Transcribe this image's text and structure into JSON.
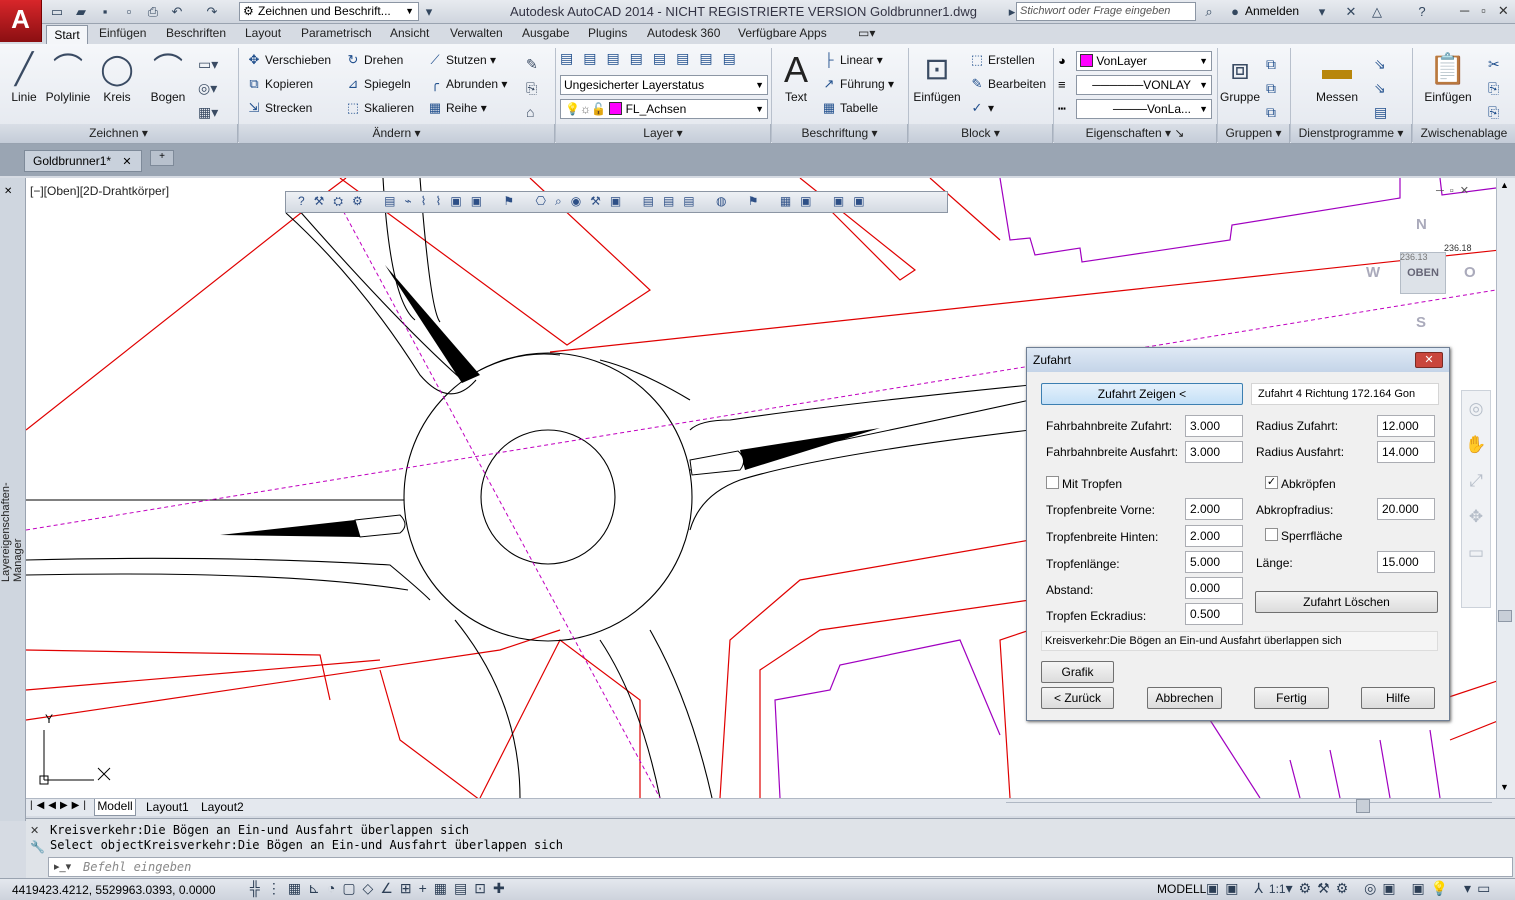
{
  "app": {
    "logo": "A",
    "title": "Autodesk AutoCAD 2014 - NICHT REGISTRIERTE VERSION     Goldbrunner1.dwg",
    "workspace": "Zeichnen und Beschrift...",
    "search_placeholder": "Stichwort oder Frage eingeben",
    "login": "Anmelden"
  },
  "ribbon": {
    "tabs": [
      "Start",
      "Einfügen",
      "Beschriften",
      "Layout",
      "Parametrisch",
      "Ansicht",
      "Verwalten",
      "Ausgabe",
      "Plugins",
      "Autodesk 360",
      "Verfügbare Apps"
    ],
    "zeichnen": {
      "linie": "Linie",
      "polylinie": "Polylinie",
      "kreis": "Kreis",
      "bogen": "Bogen",
      "panel": "Zeichnen"
    },
    "aendern": {
      "verschieben": "Verschieben",
      "drehen": "Drehen",
      "stutzen": "Stutzen",
      "kopieren": "Kopieren",
      "spiegeln": "Spiegeln",
      "abrunden": "Abrunden",
      "strecken": "Strecken",
      "skalieren": "Skalieren",
      "reihe": "Reihe",
      "panel": "Ändern"
    },
    "layer": {
      "status": "Ungesicherter Layerstatus",
      "current": "FL_Achsen",
      "panel": "Layer",
      "layer_color": "#ff00ff"
    },
    "beschriftung": {
      "text": "Text",
      "linear": "Linear",
      "fuehrung": "Führung",
      "tabelle": "Tabelle",
      "panel": "Beschriftung"
    },
    "block": {
      "einfuegen": "Einfügen",
      "erstellen": "Erstellen",
      "bearbeiten": "Bearbeiten",
      "panel": "Block"
    },
    "eigenschaften": {
      "color": "VonLayer",
      "linetype": "VONLAY",
      "lineweight": "VonLa...",
      "panel": "Eigenschaften",
      "color_swatch": "#ff00ff"
    },
    "gruppen": {
      "gruppe": "Gruppe",
      "panel": "Gruppen"
    },
    "dienst": {
      "messen": "Messen",
      "panel": "Dienstprogramme"
    },
    "zwischen": {
      "einfuegen": "Einfügen",
      "panel": "Zwischenablage"
    }
  },
  "file_tab": "Goldbrunner1*",
  "viewport": {
    "label": "[−][Oben][2D-Drahtkörper]",
    "sidebar_label": "Layereigenschaften-Manager",
    "viewcube": {
      "n": "N",
      "s": "S",
      "w": "W",
      "o": "O",
      "face": "OBEN",
      "val1": "236.13",
      "val2": "236.18"
    },
    "ucs_y": "Y"
  },
  "dialog": {
    "title": "Zufahrt",
    "show_btn": "Zufahrt Zeigen <",
    "info": "Zufahrt 4 Richtung 172.164 Gon",
    "fahrbahnbreite_zufahrt": {
      "label": "Fahrbahnbreite Zufahrt:",
      "value": "3.000"
    },
    "fahrbahnbreite_ausfahrt": {
      "label": "Fahrbahnbreite Ausfahrt:",
      "value": "3.000"
    },
    "radius_zufahrt": {
      "label": "Radius Zufahrt:",
      "value": "12.000"
    },
    "radius_ausfahrt": {
      "label": "Radius Ausfahrt:",
      "value": "14.000"
    },
    "mit_tropfen": {
      "label": "Mit Tropfen",
      "checked": false
    },
    "abkroepfen": {
      "label": "Abkröpfen",
      "checked": true
    },
    "tropfenbreite_vorne": {
      "label": "Tropfenbreite Vorne:",
      "value": "2.000"
    },
    "abkropfradius": {
      "label": "Abkropfradius:",
      "value": "20.000"
    },
    "tropfenbreite_hinten": {
      "label": "Tropfenbreite Hinten:",
      "value": "2.000"
    },
    "sperrflaeche": {
      "label": "Sperrfläche",
      "checked": false
    },
    "tropfenlaenge": {
      "label": "Tropfenlänge:",
      "value": "5.000"
    },
    "laenge": {
      "label": "Länge:",
      "value": "15.000"
    },
    "abstand": {
      "label": "Abstand:",
      "value": "0.000"
    },
    "tropfen_eckradius": {
      "label": "Tropfen Eckradius:",
      "value": "0.500"
    },
    "loeschen_btn": "Zufahrt Löschen",
    "message": "Kreisverkehr:Die Bögen an Ein-und Ausfahrt überlappen sich",
    "grafik_btn": "Grafik",
    "zurueck_btn": "< Zurück",
    "abbrechen_btn": "Abbrechen",
    "fertig_btn": "Fertig",
    "hilfe_btn": "Hilfe"
  },
  "layout_tabs": [
    "Modell",
    "Layout1",
    "Layout2"
  ],
  "command": {
    "line1": "Kreisverkehr:Die Bögen an Ein-und Ausfahrt überlappen sich",
    "line2": "Select objectKreisverkehr:Die Bögen an Ein-und Ausfahrt überlappen sich",
    "placeholder": "Befehl eingeben"
  },
  "status": {
    "coords": "4419423.4212, 5529963.0393, 0.0000",
    "modell": "MODELL",
    "scale": "1:1"
  }
}
